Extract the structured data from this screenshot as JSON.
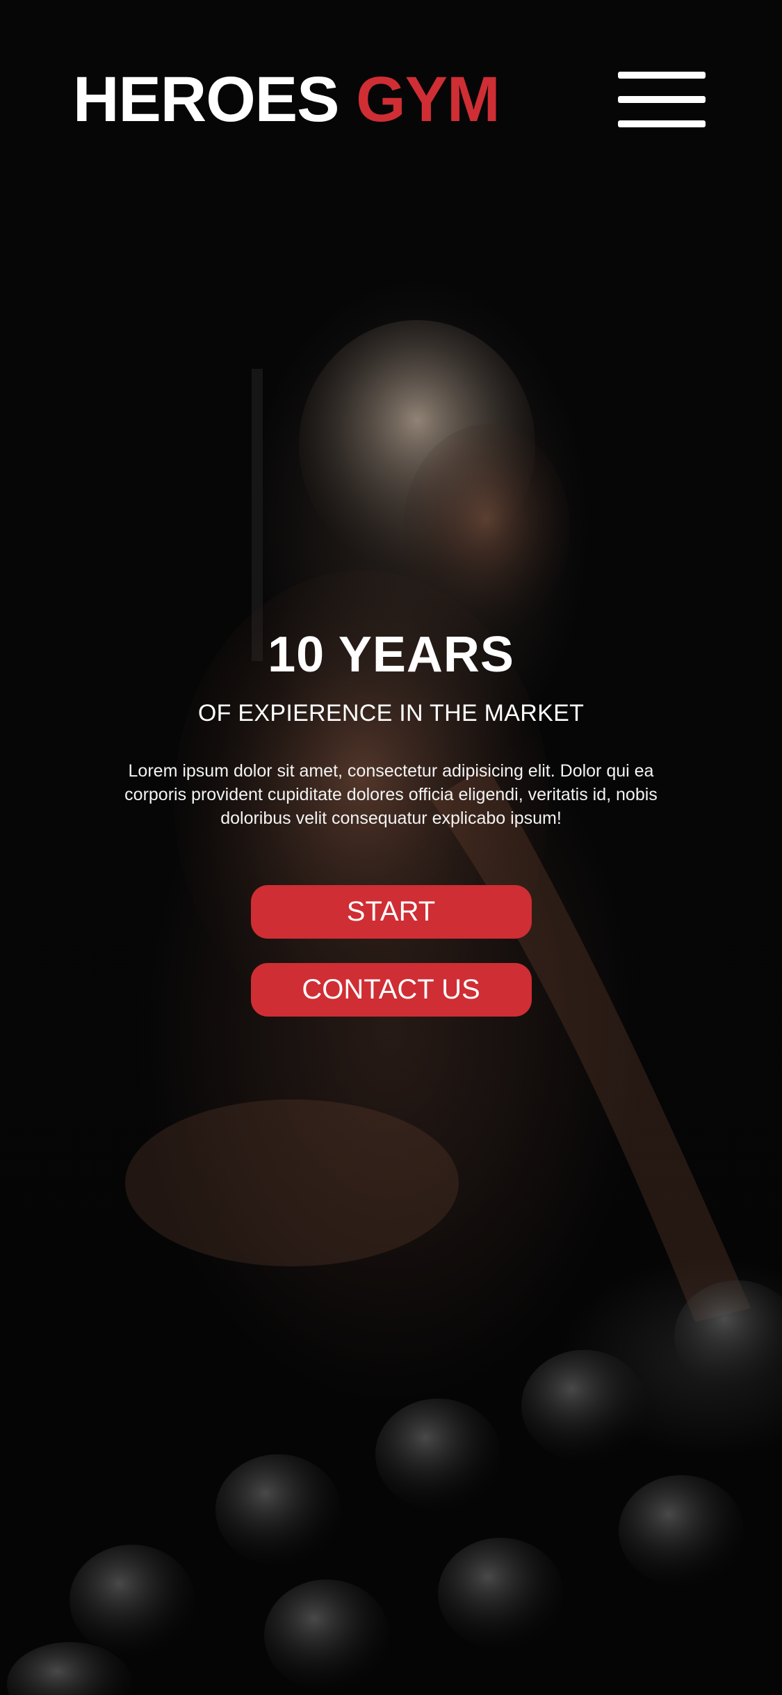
{
  "header": {
    "logo_primary": "HEROES",
    "logo_accent": "GYM"
  },
  "hero": {
    "headline": "10 YEARS",
    "subheadline": "OF EXPIERENCE IN THE MARKET",
    "body": "Lorem ipsum dolor sit amet, consectetur adipisicing elit. Dolor qui ea corporis provident cupiditate dolores officia eligendi, veritatis id, nobis doloribus velit consequatur explicabo ipsum!",
    "start_label": "START",
    "contact_label": "CONTACT US"
  },
  "colors": {
    "accent": "#cf2e34",
    "background": "#050505",
    "text": "#ffffff"
  },
  "icons": {
    "menu": "hamburger-menu-icon"
  }
}
